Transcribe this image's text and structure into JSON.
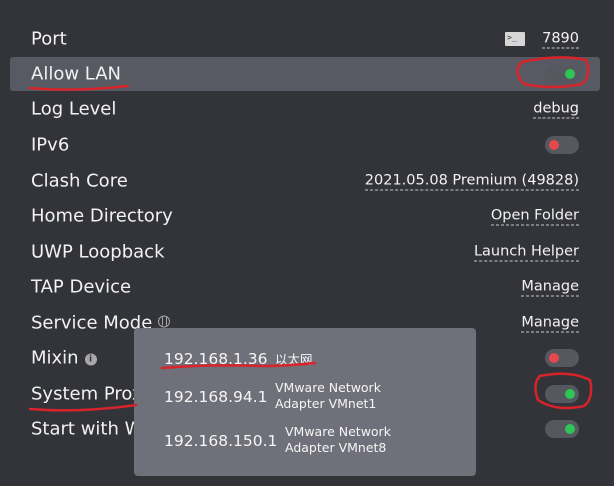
{
  "settings": {
    "port": {
      "label": "Port",
      "value": "7890",
      "terminal_icon": "terminal-icon",
      "terminal_glyph": ">_"
    },
    "allow_lan": {
      "label": "Allow LAN",
      "enabled": true
    },
    "log_level": {
      "label": "Log Level",
      "value": "debug"
    },
    "ipv6": {
      "label": "IPv6",
      "enabled": false
    },
    "clash_core": {
      "label": "Clash Core",
      "value": "2021.05.08 Premium (49828)"
    },
    "home_directory": {
      "label": "Home Directory",
      "value": "Open Folder"
    },
    "uwp_loopback": {
      "label": "UWP Loopback",
      "value": "Launch Helper"
    },
    "tap_device": {
      "label": "TAP Device",
      "value": "Manage"
    },
    "service_mode": {
      "label": "Service Mode",
      "value": "Manage",
      "icon": "globe-icon"
    },
    "mixin": {
      "label": "Mixin",
      "enabled": false,
      "icon": "info-icon"
    },
    "system_proxy": {
      "label": "System Proxy",
      "visible_label": "System Prox",
      "enabled": true
    },
    "start_with_windows": {
      "label": "Start with Windows",
      "visible_label": "Start with W",
      "enabled": true
    }
  },
  "ip_popup": {
    "entries": [
      {
        "ip": "192.168.1.36",
        "adapter_line1": "以太网",
        "adapter_line2": ""
      },
      {
        "ip": "192.168.94.1",
        "adapter_line1": "VMware Network",
        "adapter_line2": "Adapter VMnet1"
      },
      {
        "ip": "192.168.150.1",
        "adapter_line1": "VMware Network",
        "adapter_line2": "Adapter VMnet8"
      }
    ]
  },
  "colors": {
    "background": "#333439",
    "row_highlight": "#575a62",
    "toggle_on": "#2fc456",
    "toggle_off": "#e5484d",
    "popup_bg": "#6f707a",
    "annotation": "#d8232a"
  }
}
